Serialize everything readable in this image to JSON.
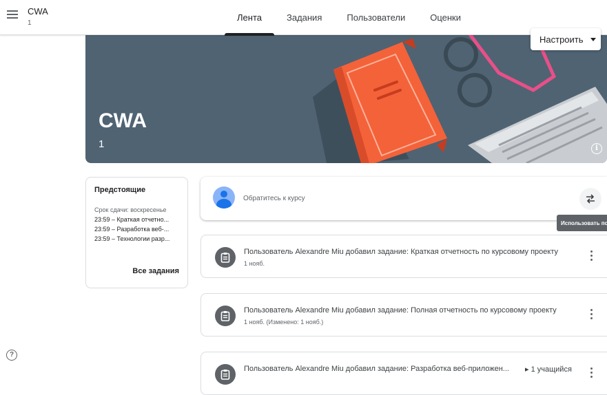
{
  "header": {
    "class_name": "CWA",
    "class_section": "1",
    "tabs": [
      {
        "label": "Лента",
        "active": true
      },
      {
        "label": "Задания",
        "active": false
      },
      {
        "label": "Пользователи",
        "active": false
      },
      {
        "label": "Оценки",
        "active": false
      }
    ]
  },
  "banner": {
    "title": "CWA",
    "section": "1",
    "customize_label": "Настроить",
    "info_glyph": "i"
  },
  "upcoming": {
    "title": "Предстоящие",
    "due_label": "Срок сдачи: воскресенье",
    "items": [
      "23:59 – Краткая отчетно...",
      "23:59 – Разработка веб-...",
      "23:59 – Технологии разр..."
    ],
    "all_label": "Все задания"
  },
  "announce": {
    "placeholder": "Обратитесь к курсу",
    "tooltip": "Использовать повт"
  },
  "posts": [
    {
      "title": "Пользователь Alexandre Miu добавил задание: Краткая отчетность по курсовому проекту",
      "date": "1 нояб.",
      "badge": ""
    },
    {
      "title": "Пользователь Alexandre Miu добавил задание: Полная отчетность по курсовому проекту",
      "date": "1 нояб. (Изменено: 1 нояб.)",
      "badge": ""
    },
    {
      "title": "Пользователь Alexandre Miu добавил задание: Разработка веб-приложен...",
      "date": "",
      "badge": "▸ 1 учащийся"
    }
  ],
  "footer": {
    "help_glyph": "?"
  },
  "colors": {
    "banner": "#4f6373",
    "book": "#f4623a",
    "glasses": "#e94f88",
    "accent_blue": "#1a73e8"
  }
}
